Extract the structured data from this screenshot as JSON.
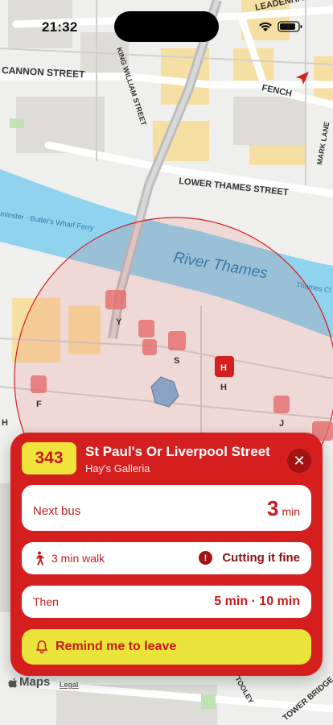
{
  "status_bar": {
    "time": "21:32"
  },
  "map": {
    "streets": {
      "leadenhall": "LEADENHALL STREET",
      "cannon": "CANNON STREET",
      "king_william": "KING WILLIAM STREET",
      "fenchurch": "FENCH",
      "mark_lane": "MARK LANE",
      "lower_thames": "LOWER THAMES STREET",
      "tooley": "TOOLEY",
      "tower_bridge": "TOWER BRIDGE ROAD"
    },
    "river": "River Thames",
    "river_small": "Thames Cl",
    "ferry": "minster - Butler's Wharf Ferry",
    "stop_letters": [
      "Y",
      "S",
      "H",
      "F",
      "J",
      "H"
    ],
    "attribution": "Maps",
    "legal": "Legal",
    "colors": {
      "water": "#8fd3ee",
      "radius": "#d51f1f",
      "building": "#f6dfa2"
    }
  },
  "card": {
    "route": "343",
    "destination": "St Paul's Or Liverpool Street",
    "stop_name": "Hay's Galleria",
    "next_bus_label": "Next bus",
    "next_bus_value": "3",
    "next_bus_unit": "min",
    "walk_label": "3 min walk",
    "warning_label": "Cutting it fine",
    "then_label": "Then",
    "then_value": "5 min · 10 min",
    "remind_label": "Remind me to leave",
    "colors": {
      "card": "#d51f1f",
      "badge": "#f0e43a",
      "button": "#e9e33a"
    }
  }
}
